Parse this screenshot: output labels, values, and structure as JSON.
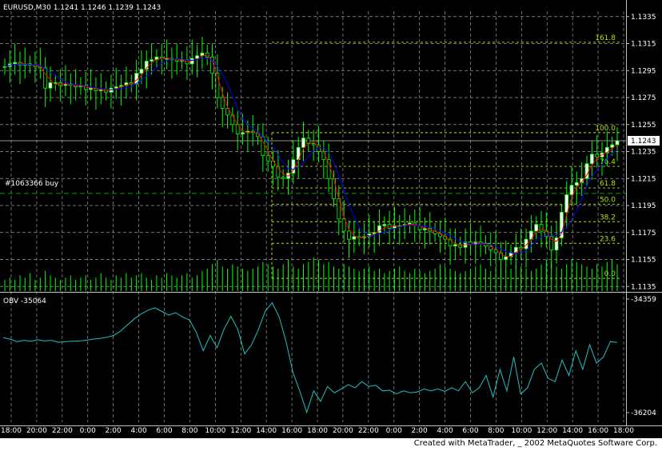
{
  "chart_data": {
    "type": "candlestick",
    "symbol_header": "EURUSD,M30  1.1241 1.1246 1.1239 1.1243",
    "price_axis": {
      "ticks": [
        "1.1335",
        "1.1315",
        "1.1295",
        "1.1275",
        "1.1255",
        "1.1235",
        "1.1215",
        "1.1195",
        "1.1175",
        "1.1155",
        "1.1135"
      ],
      "ylim": [
        1.1131,
        1.1339
      ]
    },
    "current_price_label": "1.1243",
    "current_price": 1.1243,
    "order_label": "#1063366 buy",
    "order_price": 1.1204,
    "time_ticks": [
      "18:00",
      "20:00",
      "22:00",
      "0:00",
      "2:00",
      "4:00",
      "6:00",
      "8:00",
      "10:00",
      "12:00",
      "14:00",
      "16:00",
      "18:00",
      "20:00",
      "22:00",
      "0:00",
      "2:00",
      "4:00",
      "6:00",
      "8:00",
      "10:00",
      "12:00",
      "14:00",
      "16:00",
      "18:00"
    ],
    "fibonacci": {
      "levels": [
        {
          "label": "161.8",
          "price": 1.1316
        },
        {
          "label": "100.0",
          "price": 1.1249
        },
        {
          "label": "76.4",
          "price": 1.1224
        },
        {
          "label": "61.8",
          "price": 1.1208
        },
        {
          "label": "50.0",
          "price": 1.1196
        },
        {
          "label": "38.2",
          "price": 1.1183
        },
        {
          "label": "23.6",
          "price": 1.1167
        },
        {
          "label": "0.0",
          "price": 1.1141
        }
      ]
    },
    "close_series": [
      1.1298,
      1.13,
      1.1301,
      1.1299,
      1.13,
      1.1299,
      1.1298,
      1.1297,
      1.1282,
      1.1286,
      1.1286,
      1.1284,
      1.1285,
      1.1284,
      1.1283,
      1.1284,
      1.1281,
      1.1282,
      1.128,
      1.1281,
      1.1279,
      1.1282,
      1.1283,
      1.1284,
      1.1286,
      1.1285,
      1.1293,
      1.1296,
      1.1302,
      1.1303,
      1.1305,
      1.1304,
      1.1304,
      1.1303,
      1.1302,
      1.1303,
      1.13,
      1.1304,
      1.1306,
      1.1308,
      1.1305,
      1.1293,
      1.1275,
      1.1267,
      1.1262,
      1.1255,
      1.1248,
      1.1249,
      1.125,
      1.1249,
      1.1246,
      1.1232,
      1.1228,
      1.1224,
      1.1216,
      1.1215,
      1.1219,
      1.1229,
      1.1238,
      1.1245,
      1.1241,
      1.124,
      1.1235,
      1.1229,
      1.1215,
      1.12,
      1.1185,
      1.1176,
      1.117,
      1.1172,
      1.1171,
      1.1172,
      1.1174,
      1.1175,
      1.118,
      1.1181,
      1.1178,
      1.118,
      1.118,
      1.1181,
      1.1182,
      1.118,
      1.1177,
      1.1178,
      1.1176,
      1.1174,
      1.1172,
      1.117,
      1.1165,
      1.1166,
      1.1164,
      1.1168,
      1.1166,
      1.1168,
      1.1167,
      1.1165,
      1.1162,
      1.116,
      1.1155,
      1.1157,
      1.116,
      1.1164,
      1.1163,
      1.117,
      1.1176,
      1.1181,
      1.1176,
      1.1172,
      1.1162,
      1.1171,
      1.119,
      1.1203,
      1.121,
      1.1212,
      1.1215,
      1.1226,
      1.1233,
      1.1231,
      1.1234,
      1.1238,
      1.124,
      1.1243
    ],
    "volume_series": [
      5,
      6,
      5,
      7,
      6,
      8,
      5,
      6,
      9,
      7,
      6,
      5,
      6,
      7,
      5,
      6,
      7,
      5,
      6,
      8,
      6,
      5,
      7,
      6,
      8,
      6,
      7,
      8,
      6,
      5,
      7,
      6,
      8,
      7,
      6,
      7,
      8,
      6,
      7,
      9,
      10,
      12,
      14,
      11,
      10,
      12,
      11,
      10,
      9,
      10,
      11,
      13,
      12,
      11,
      10,
      12,
      14,
      11,
      10,
      12,
      13,
      15,
      14,
      12,
      13,
      11,
      10,
      12,
      11,
      10,
      9,
      10,
      11,
      9,
      10,
      8,
      9,
      10,
      11,
      9,
      8,
      10,
      9,
      8,
      9,
      10,
      12,
      11,
      10,
      9,
      8,
      9,
      10,
      11,
      12,
      10,
      9,
      11,
      10,
      9,
      10,
      12,
      11,
      10,
      9,
      10,
      12,
      14,
      13,
      11,
      10,
      12,
      14,
      13,
      12,
      11,
      10,
      12,
      11,
      13,
      14,
      12,
      11,
      10
    ],
    "obv": {
      "label": "OBV  -35064",
      "axis_max_label": "-34359",
      "axis_min_label": "-36204",
      "ylim": [
        -36204,
        -34359
      ],
      "values": [
        -34985,
        -35010,
        -35050,
        -35030,
        -35045,
        -35020,
        -35040,
        -35030,
        -35060,
        -35050,
        -35045,
        -35040,
        -35030,
        -35010,
        -35000,
        -34980,
        -34950,
        -34880,
        -34780,
        -34680,
        -34600,
        -34540,
        -34500,
        -34560,
        -34620,
        -34580,
        -34650,
        -34700,
        -34900,
        -35200,
        -34950,
        -35150,
        -34850,
        -34640,
        -34850,
        -35250,
        -35100,
        -34850,
        -34550,
        -34420,
        -34650,
        -35050,
        -35550,
        -35860,
        -36200,
        -35850,
        -36020,
        -35780,
        -35880,
        -35820,
        -35750,
        -35800,
        -35700,
        -35780,
        -35760,
        -35850,
        -35840,
        -35900,
        -35850,
        -35880,
        -35870,
        -35820,
        -35850,
        -35820,
        -35860,
        -35800,
        -35850,
        -35700,
        -35880,
        -35800,
        -35600,
        -35950,
        -35500,
        -35850,
        -35300,
        -35900,
        -35800,
        -35500,
        -35400,
        -35650,
        -35700,
        -35350,
        -35600,
        -35200,
        -35500,
        -35100,
        -35400,
        -35300,
        -35050,
        -35064
      ]
    }
  },
  "footer": {
    "credit": "Created with MetaTrader, _ 2002 MetaQuotes Software Corp."
  },
  "colors": {
    "background": "#000000",
    "grid": "#c0c0c0",
    "bull": "#00ff00",
    "bull_body": "#ffffff",
    "bear_body": "#000000",
    "ma_fast": "#ff0000",
    "ma_slow": "#0000ff",
    "fib": "#b4e400",
    "obv_line": "#20c0c0",
    "text": "#ffffff",
    "price_label_bg": "#ffffff"
  }
}
